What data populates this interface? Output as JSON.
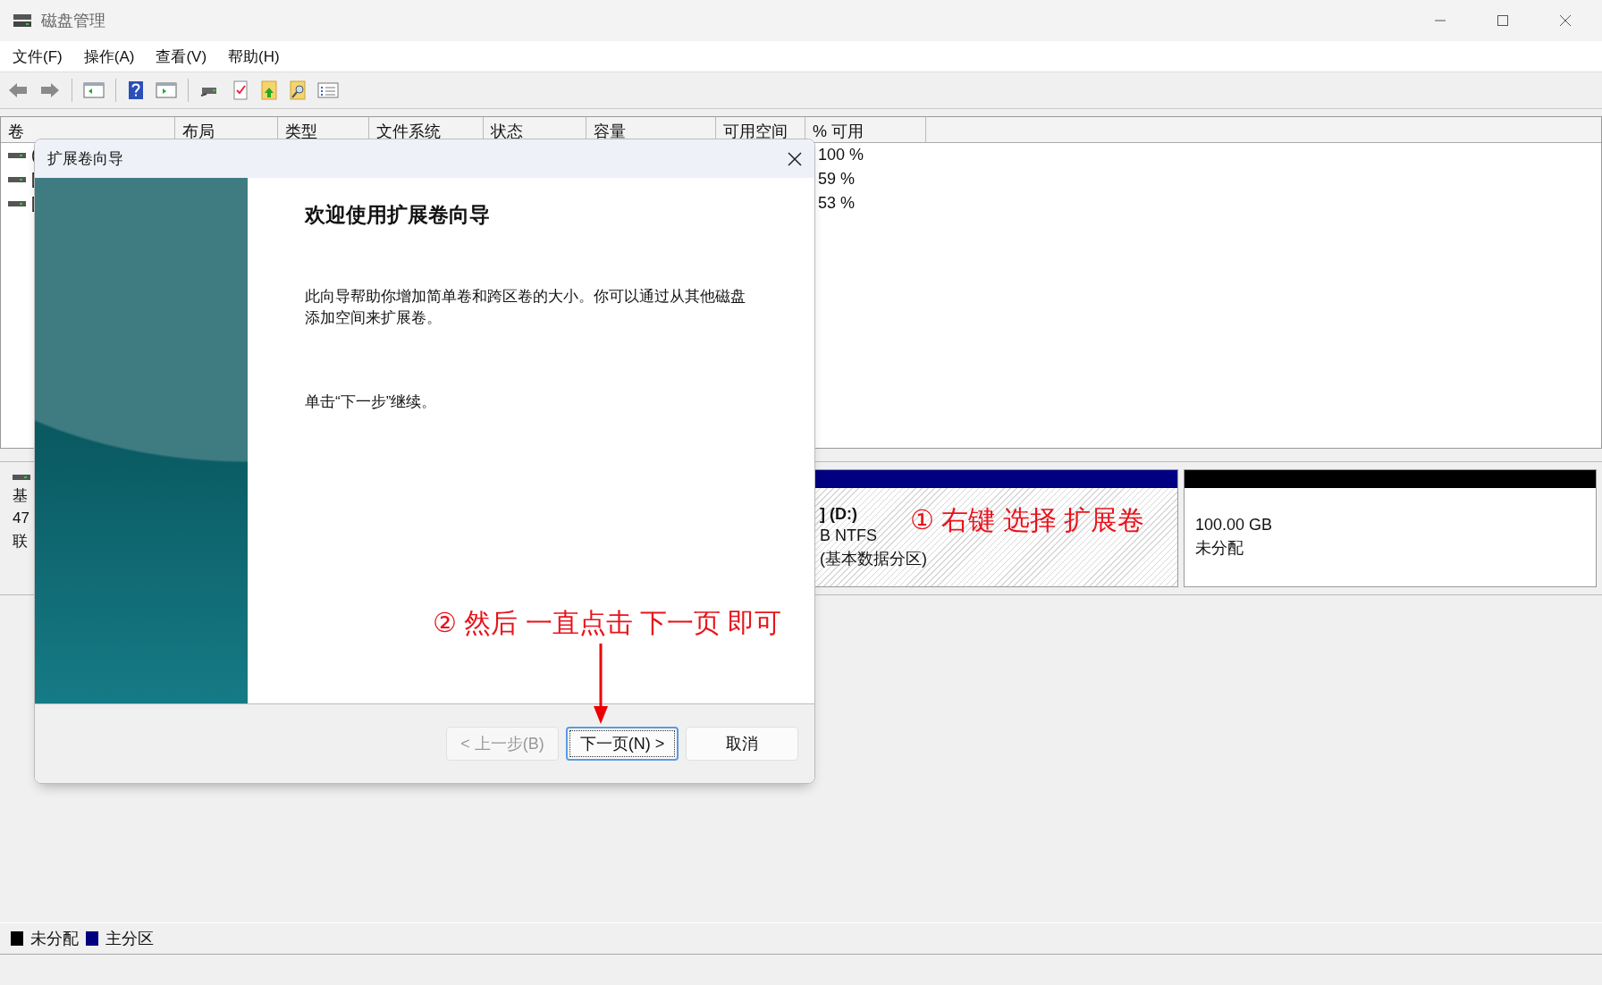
{
  "window": {
    "title": "磁盘管理"
  },
  "menu": [
    {
      "label": "文件(F)"
    },
    {
      "label": "操作(A)"
    },
    {
      "label": "查看(V)"
    },
    {
      "label": "帮助(H)"
    }
  ],
  "table": {
    "columns": [
      "卷",
      "布局",
      "类型",
      "文件系统",
      "状态",
      "容量",
      "可用空间",
      "% 可用"
    ],
    "rows": [
      {
        "volume": "(",
        "percent_free": "100 %"
      },
      {
        "volume": "[",
        "percent_free": "59 %"
      },
      {
        "volume": "[",
        "percent_free": "53 %"
      }
    ]
  },
  "disk": {
    "label_lines": [
      "基",
      "47",
      "联"
    ],
    "partitions": [
      {
        "kind": "primary",
        "color": "#000080",
        "lines": [
          "] (D:)",
          "B NTFS",
          "(基本数据分区)"
        ]
      },
      {
        "kind": "unallocated",
        "color": "#000000",
        "lines": [
          "100.00 GB",
          "未分配"
        ]
      }
    ]
  },
  "legend": [
    {
      "label": "未分配",
      "color": "#000000"
    },
    {
      "label": "主分区",
      "color": "#000080"
    }
  ],
  "dialog": {
    "title": "扩展卷向导",
    "heading": "欢迎使用扩展卷向导",
    "body": "此向导帮助你增加简单卷和跨区卷的大小。你可以通过从其他磁盘添加空间来扩展卷。",
    "hint": "单击“下一步”继续。",
    "buttons": [
      {
        "label": "< 上一步(B)",
        "disabled": true,
        "default": false
      },
      {
        "label": "下一页(N) >",
        "disabled": false,
        "default": true
      },
      {
        "label": "取消",
        "disabled": false,
        "default": false
      }
    ]
  },
  "annotations": [
    {
      "text": "① 右键 选择 扩展卷"
    },
    {
      "text": "② 然后 一直点击 下一页 即可"
    }
  ]
}
